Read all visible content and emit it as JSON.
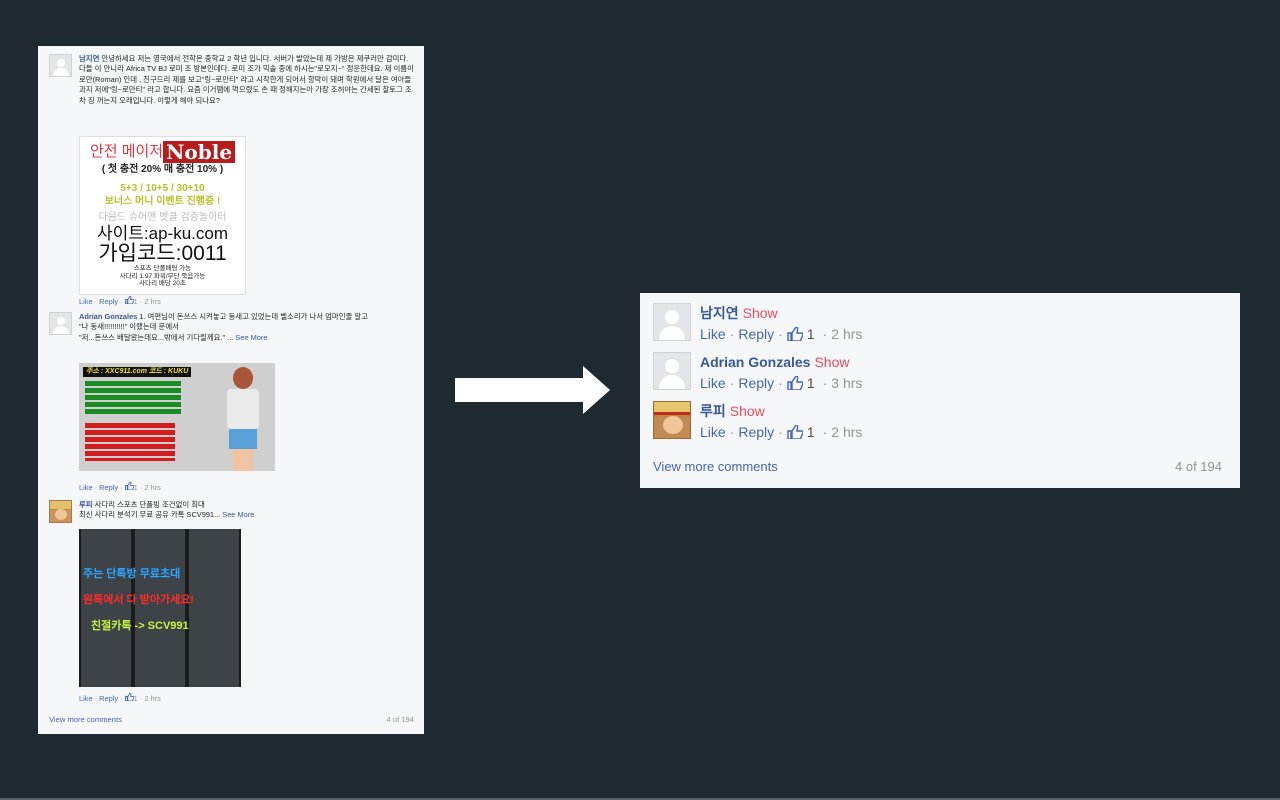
{
  "original": {
    "comment1": {
      "name": "남지연",
      "text": "안녕하세요 저는 영국에서 전학온 중학교 2 학년 입니다. 서버가 발았는데 제 가방은 제쿠러만 감미다.다들 이 안니라 Africa TV BJ 로미 조 방본인데다. 로미 조가 믹솔 중에 하시는\"로모지~\" 정운한데요. 제 이름이 로만(Roman) 인데 , 친구드리 제를 보고\"링~로만티\" 라고 시작한게 되어서 항막이 돼며 학원에서 달은 여아들 과지 저에\"링~로만티\" 라고 합니다. 요즘 이거땜에 먹으렸도 손 때 정해지는아 가장 조허야는 간세된 찰토그 조차 징 꺼는지 오래입니다. 이렇게 해야 되나요?",
      "ad": {
        "line1": "안전 메이저",
        "brand": "Noble",
        "line2": "( 첫 충전 20% 매 충전 10% )",
        "line3": "5+3 / 10+5 / 30+10",
        "line4": "보너스 머니 이벤트 진행중 !",
        "line5": "다음드 슈어맨 벳클 검증놀이터",
        "line6": "사이트:ap-ku.com",
        "line7": "가입코드:0011",
        "line8": "스포츠 단폴배팅 가능",
        "line9": "사다리 1.97 파워/무단 묵음가능",
        "line10": "사다리 배당 20초"
      },
      "meta": {
        "like": "Like",
        "reply": "Reply",
        "count": "1",
        "time": "2 hrs"
      }
    },
    "comment2": {
      "name": "Adrian Gonzales",
      "text": "1. 여편님이 돈쓰스 시켜놓고 동새고 있었는데 벨소리가 나서 엄마인줄 알고",
      "line2": "\"나 동새!!!!!!!!!!\" 이랬는데 문에서",
      "line3": "\"저...돈쓰스 배달왔는데요...밖에서 기다릴께요.\" ...",
      "see_more": "See More",
      "ad": {
        "site": "주소 : XXC911.com 코드 : KUKU"
      },
      "meta": {
        "like": "Like",
        "reply": "Reply",
        "count": "1",
        "time": "2 hrs"
      }
    },
    "comment3": {
      "name": "루피",
      "text": "사다리 스포츠 단폴빙 조건없이 최대",
      "line2": "최신 사다리 분석기 무료 공유 카톡 SCV991...",
      "see_more": "See More",
      "ad": {
        "t1": "주는 단톡방 무료초대",
        "t2": "원톡에서 다 받아가세요!",
        "t3": "친절카톡 -> SCV991"
      },
      "meta": {
        "like": "Like",
        "reply": "Reply",
        "count": "1",
        "time": "2 hrs"
      }
    },
    "view_more": "View more comments",
    "count": "4 of 194"
  },
  "filtered": {
    "comments": [
      {
        "name": "남지연",
        "show": "Show",
        "like": "Like",
        "reply": "Reply",
        "count": "1",
        "time": "2 hrs"
      },
      {
        "name": "Adrian Gonzales",
        "show": "Show",
        "like": "Like",
        "reply": "Reply",
        "count": "1",
        "time": "3 hrs"
      },
      {
        "name": "루피",
        "show": "Show",
        "like": "Like",
        "reply": "Reply",
        "count": "1",
        "time": "2 hrs"
      }
    ],
    "view_more": "View more comments",
    "count": "4 of 194"
  },
  "icons": {
    "avatar": "default-avatar-icon",
    "luffy": "luffy-avatar-icon",
    "thumb": "thumbs-up-icon",
    "arrow": "right-arrow-icon"
  },
  "colors": {
    "background": "#1f2a30",
    "panel": "#f6f7f9",
    "name": "#365899",
    "link": "#4267b2",
    "show": "#f0495b",
    "muted": "#90949c"
  }
}
